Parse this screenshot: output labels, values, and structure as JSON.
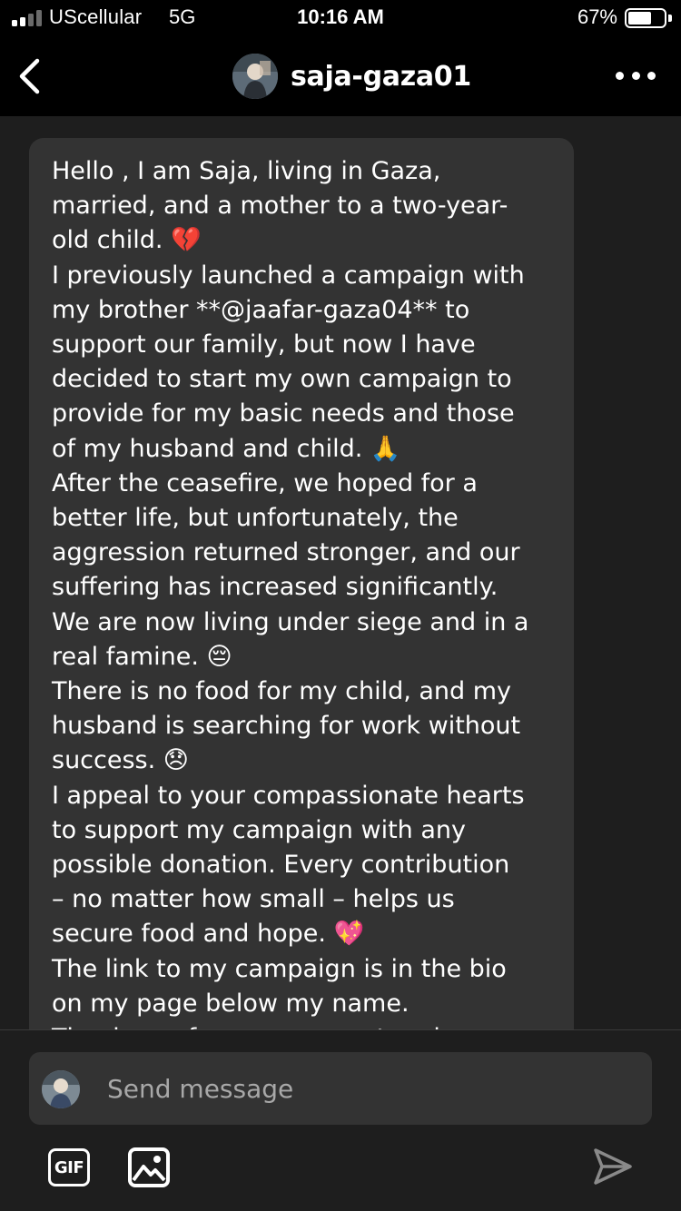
{
  "status_bar": {
    "carrier": "UScellular",
    "network": "5G",
    "time": "10:16 AM",
    "battery_percent": "67%",
    "battery_level": 0.67,
    "signal_bars_active": 2,
    "signal_bars_total": 4
  },
  "header": {
    "back_icon": "chevron-left-icon",
    "username": "saja-gaza01",
    "more_icon": "more-horizontal-icon"
  },
  "conversation": {
    "messages": [
      {
        "lines": [
          "Hello , I am Saja, living in Gaza,",
          "married, and a mother to a two-year-",
          "old child. 💔",
          "I previously launched a campaign with",
          "my brother **@jaafar-gaza04** to",
          "support our family, but now I have",
          "decided to start my own campaign to",
          "provide for my basic needs and those",
          "of my husband and child. 🙏",
          "After the ceasefire, we hoped for a",
          "better life, but unfortunately, the",
          "aggression returned stronger, and our",
          "suffering has increased significantly.",
          "We are now living under siege and in a",
          "real famine. 😔",
          "There is no food for my child, and my",
          "husband is searching for work without",
          "success. 😞",
          "I appeal to your compassionate hearts",
          "to support my campaign with any",
          "possible donation. Every contribution",
          "– no matter how small – helps us",
          "secure food and hope. 💖",
          "The link to my campaign is in the bio",
          "on my page below my name.",
          "Thank you for your support and care."
        ]
      }
    ]
  },
  "composer": {
    "placeholder": "Send message",
    "value": "",
    "gif_label": "GIF",
    "image_icon": "image-icon",
    "send_icon": "send-icon"
  },
  "colors": {
    "bar_background": "#000000",
    "page_background": "#1e1e1e",
    "bubble_background": "#333333",
    "placeholder_text": "#a8a8a8"
  }
}
